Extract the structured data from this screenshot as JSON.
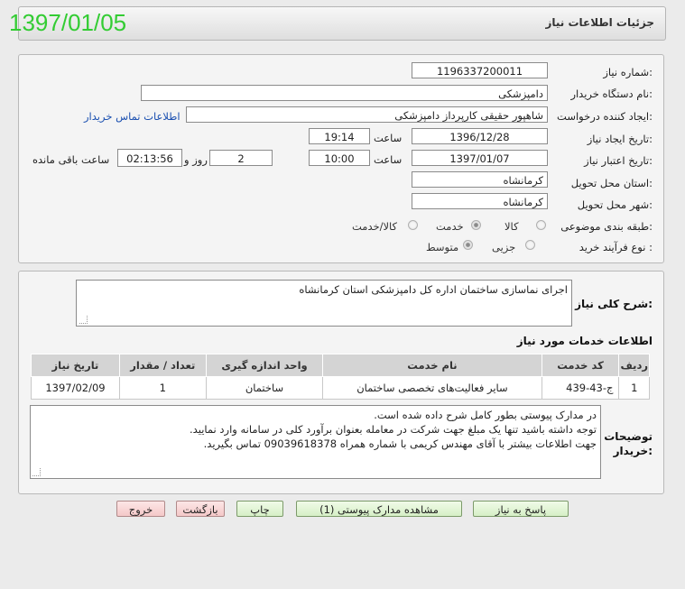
{
  "header": {
    "title": "جزئیات اطلاعات نیاز",
    "date_stamp": "1397/01/05"
  },
  "form": {
    "need_number_label": "شماره نیاز:",
    "need_number": "1196337200011",
    "buyer_org_label": "نام دستگاه خریدار:",
    "buyer_org": "دامپزشکی",
    "requester_label": "ایجاد کننده درخواست:",
    "requester": "شاهپور حقیقی کارپرداز دامپزشکی",
    "contact_link": "اطلاعات تماس خریدار",
    "created_label": "تاریخ ایجاد نیاز:",
    "created_date": "1396/12/28",
    "time_label": "ساعت",
    "created_time": "19:14",
    "valid_label": "تاریخ اعتبار نیاز:",
    "valid_date": "1397/01/07",
    "valid_time": "10:00",
    "days_value": "2",
    "days_label": "روز و",
    "countdown": "02:13:56",
    "remaining_label": "ساعت باقی مانده",
    "province_label": "استان محل تحویل:",
    "province": "کرمانشاه",
    "city_label": "شهر محل تحویل:",
    "city": "کرمانشاه",
    "category_label": "طبقه بندی موضوعی:",
    "category_options": [
      "کالا",
      "خدمت",
      "کالا/خدمت"
    ],
    "category_selected": "خدمت",
    "process_label": "نوع فرآیند خرید :",
    "process_options": [
      "جزیی",
      "متوسط"
    ],
    "process_selected": "متوسط"
  },
  "description": {
    "label": "شرح کلی نیاز:",
    "text": "اجرای نماسازی ساختمان اداره کل دامپزشکی استان کرمانشاه"
  },
  "services": {
    "title": "اطلاعات خدمات مورد نیاز",
    "columns": [
      "ردیف",
      "کد خدمت",
      "نام خدمت",
      "واحد اندازه گیری",
      "تعداد / مقدار",
      "تاریخ نیاز"
    ],
    "rows": [
      [
        "1",
        "ج-43-439",
        "سایر فعالیت‌های تخصصی ساختمان",
        "ساختمان",
        "1",
        "1397/02/09"
      ]
    ]
  },
  "notes": {
    "label_line1": "توضیحات",
    "label_line2": "خریدار:",
    "line1": "در مدارک پیوستی بطور کامل شرح داده شده است.",
    "line2": "توجه داشته باشید تنها یک مبلغ جهت شرکت در معامله بعنوان برآورد کلی در سامانه وارد نمایید.",
    "line3": "جهت اطلاعات بیشتر با آقای مهندس کریمی با شماره همراه 09039618378 تماس بگیرید."
  },
  "buttons": {
    "reply": "پاسخ به نیاز",
    "attachments": "مشاهده مدارک پیوستی (1)",
    "print": "چاپ",
    "back": "بازگشت",
    "exit": "خروج"
  },
  "colors": {
    "date_stamp": "#33cc33",
    "link": "#1a4fb0"
  }
}
